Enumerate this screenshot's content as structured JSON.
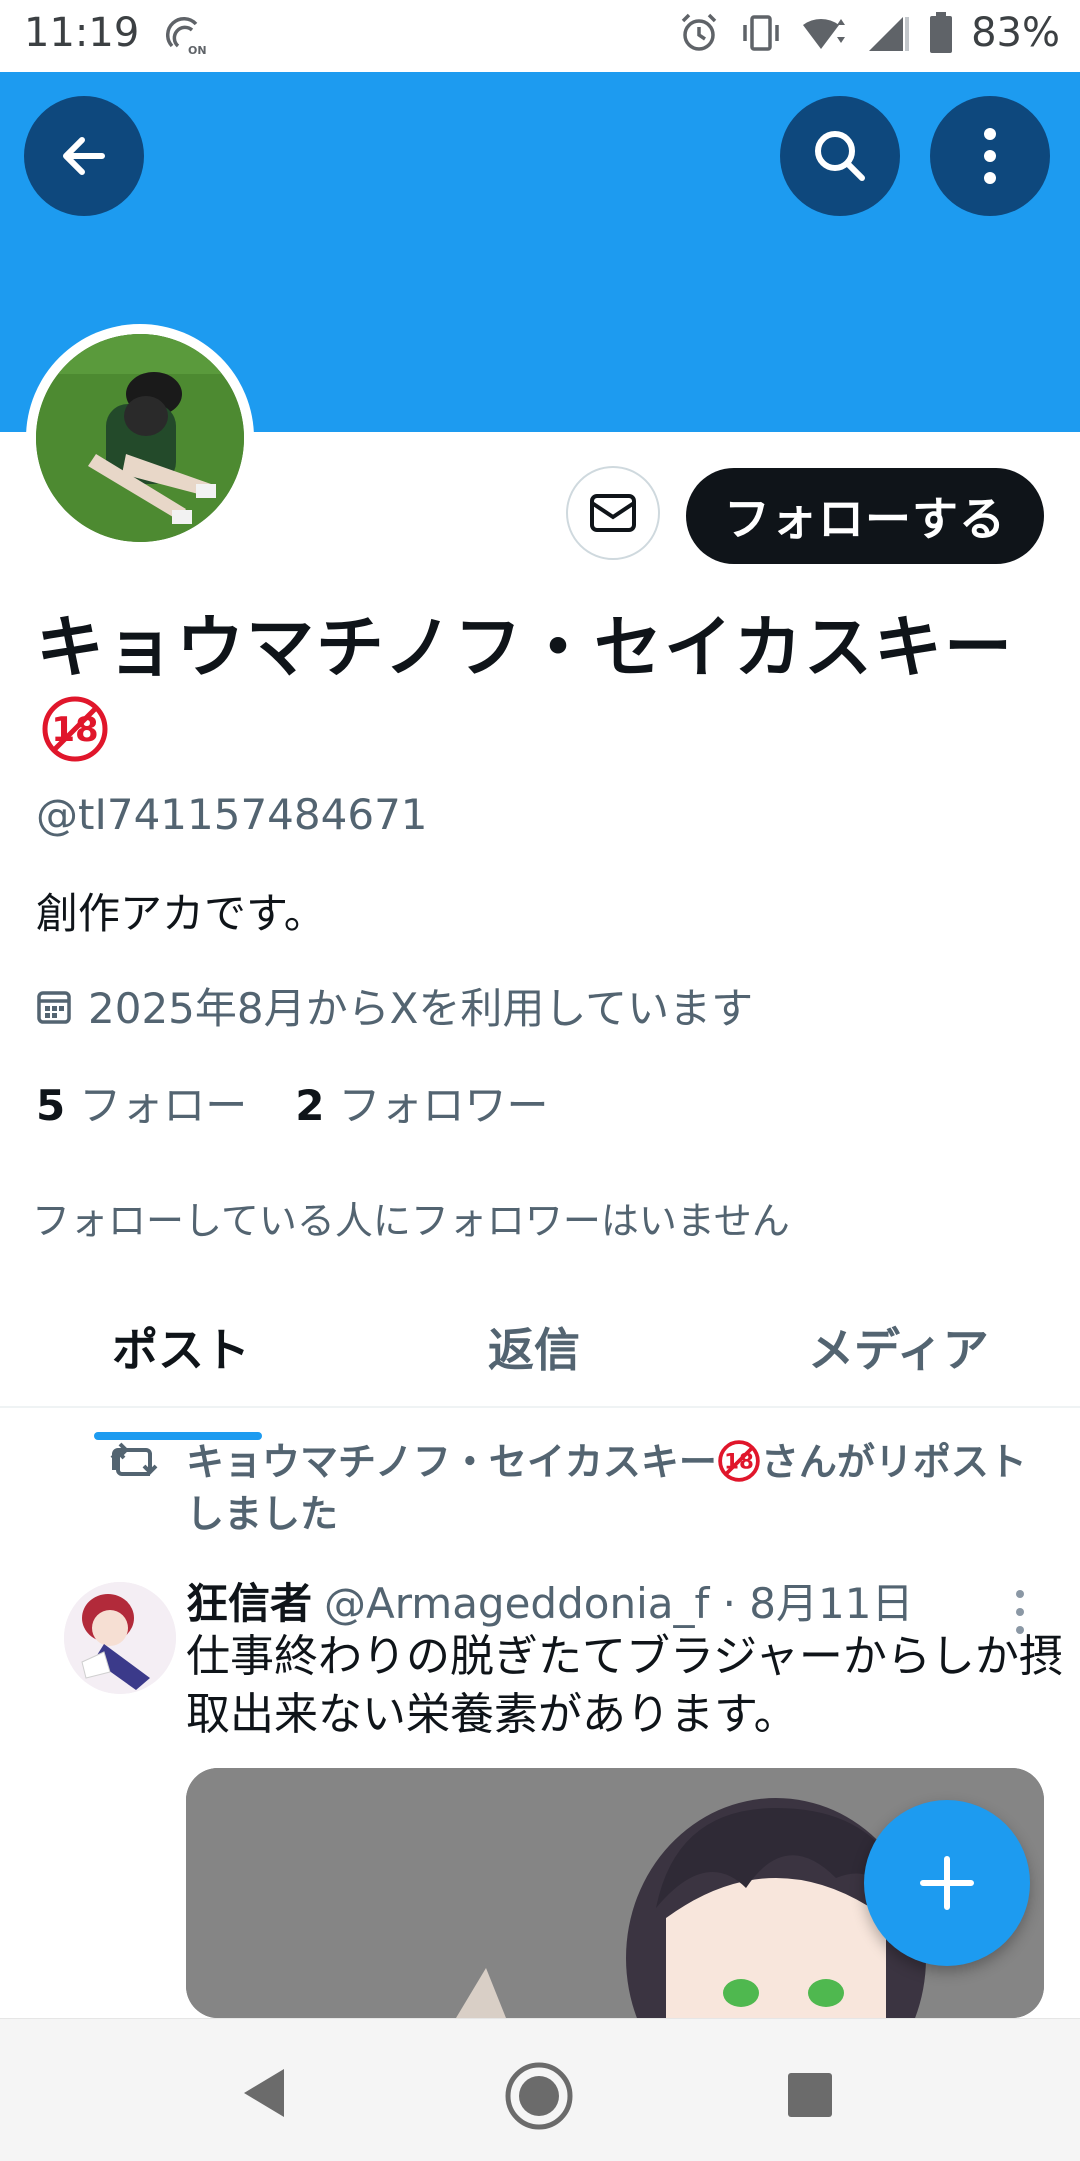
{
  "status_bar": {
    "time": "11:19",
    "battery": "83%"
  },
  "profile": {
    "display_name": "キョウマチノフ・セイカスキー",
    "r18_badge_text": "18",
    "handle": "@tI741157484671",
    "bio": "創作アカです。",
    "joined": "2025年8月からXを利用しています",
    "following_count": "5",
    "following_label": "フォロー",
    "followers_count": "2",
    "followers_label": "フォロワー",
    "no_mutual_followers": "フォローしている人にフォロワーはいません",
    "follow_button_label": "フォローする"
  },
  "tabs": [
    {
      "label": "ポスト",
      "selected": true
    },
    {
      "label": "返信",
      "selected": false
    },
    {
      "label": "メディア",
      "selected": false
    }
  ],
  "timeline": {
    "repost_by": "キョウマチノフ・セイカスキー",
    "repost_suffix": "さんがリポストしました",
    "post": {
      "author": "狂信者",
      "handle_date": "@Armageddonia_f · 8月11日",
      "text": "仕事終わりの脱ぎたてブラジャーからしか摂取出来ない栄養素があります。"
    }
  },
  "icons": {
    "back": "arrow-left-icon",
    "search": "search-icon",
    "more": "more-vertical-icon",
    "message": "envelope-icon",
    "calendar": "calendar-icon",
    "repost": "repost-icon",
    "compose": "plus-icon"
  },
  "colors": {
    "accent": "#1d9bf0",
    "text_primary": "#0f1419",
    "text_secondary": "#536471",
    "r18_red": "#e0162b"
  }
}
